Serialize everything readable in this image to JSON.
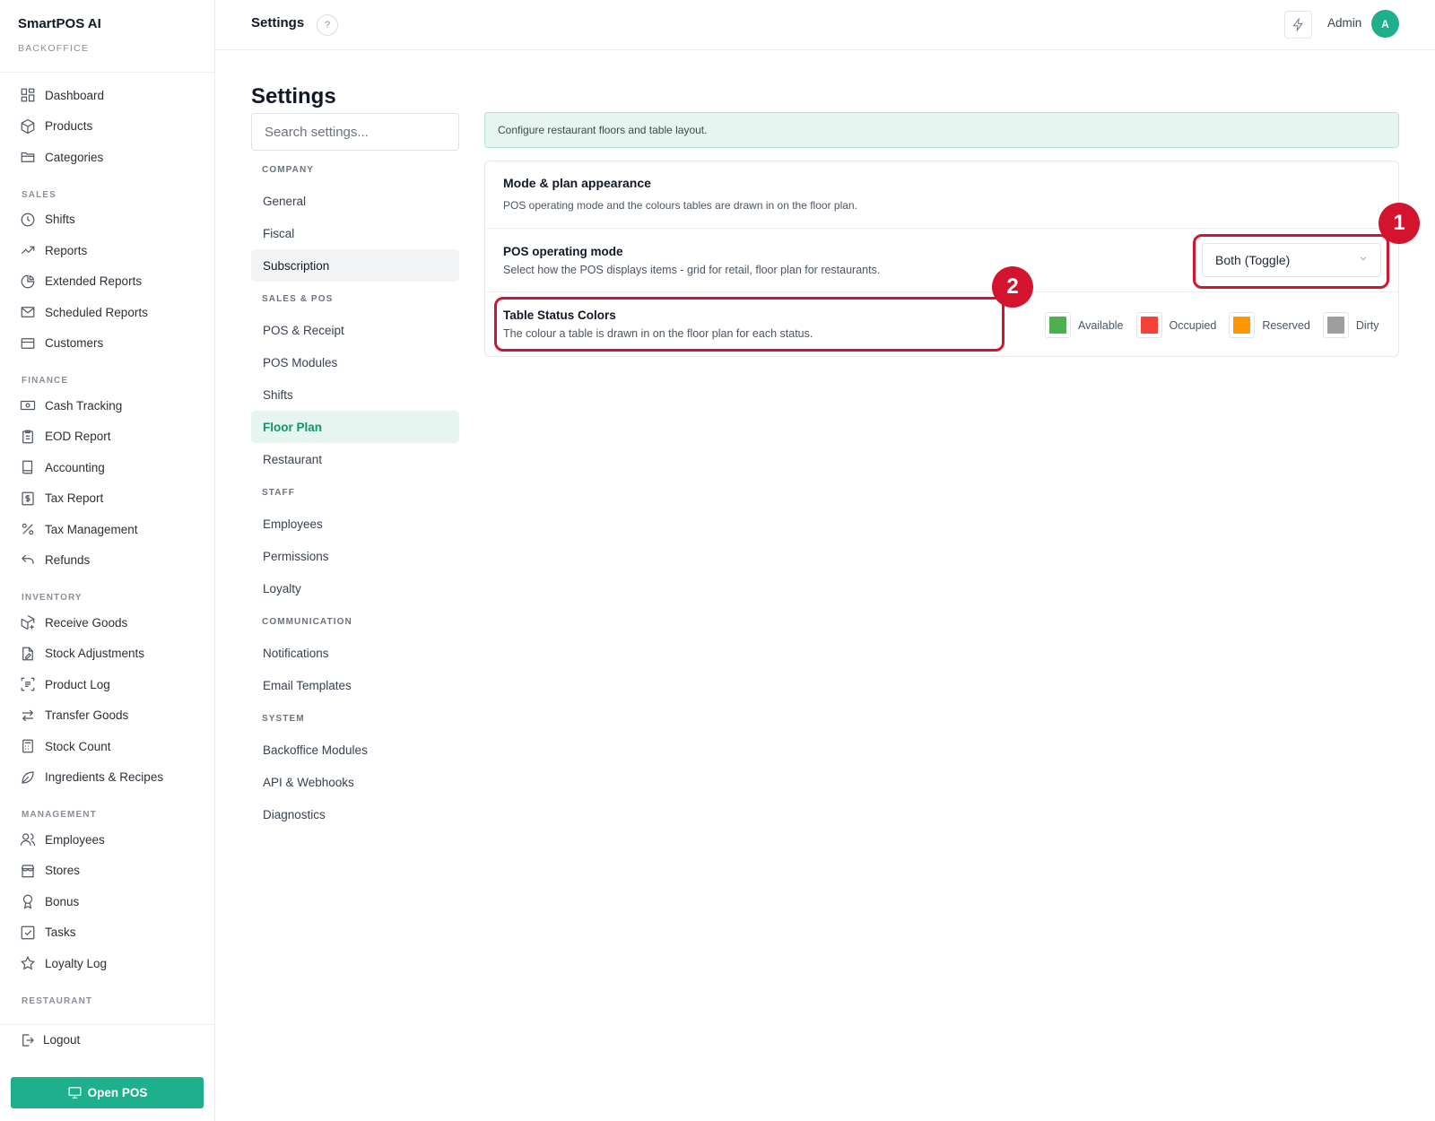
{
  "app": {
    "name": "SmartPOS AI",
    "subtitle": "BACKOFFICE"
  },
  "sidebar": {
    "top_items": [
      {
        "label": "Dashboard",
        "icon": "dashboard-icon"
      },
      {
        "label": "Products",
        "icon": "box-icon"
      },
      {
        "label": "Categories",
        "icon": "folder-icon"
      }
    ],
    "sections": [
      {
        "title": "SALES",
        "items": [
          {
            "label": "Shifts",
            "icon": "clock-icon"
          },
          {
            "label": "Reports",
            "icon": "trend-icon"
          },
          {
            "label": "Extended Reports",
            "icon": "pie-icon"
          },
          {
            "label": "Scheduled Reports",
            "icon": "mail-icon"
          },
          {
            "label": "Customers",
            "icon": "card-icon"
          }
        ]
      },
      {
        "title": "FINANCE",
        "items": [
          {
            "label": "Cash Tracking",
            "icon": "cash-icon"
          },
          {
            "label": "EOD Report",
            "icon": "clipboard-icon"
          },
          {
            "label": "Accounting",
            "icon": "book-icon"
          },
          {
            "label": "Tax Report",
            "icon": "dollar-doc-icon"
          },
          {
            "label": "Tax Management",
            "icon": "percent-icon"
          },
          {
            "label": "Refunds",
            "icon": "undo-icon"
          }
        ]
      },
      {
        "title": "INVENTORY",
        "items": [
          {
            "label": "Receive Goods",
            "icon": "package-plus-icon"
          },
          {
            "label": "Stock Adjustments",
            "icon": "doc-edit-icon"
          },
          {
            "label": "Product Log",
            "icon": "scan-list-icon"
          },
          {
            "label": "Transfer Goods",
            "icon": "transfer-icon"
          },
          {
            "label": "Stock Count",
            "icon": "calculator-icon"
          },
          {
            "label": "Ingredients & Recipes",
            "icon": "leaf-icon"
          }
        ]
      },
      {
        "title": "MANAGEMENT",
        "items": [
          {
            "label": "Employees",
            "icon": "users-icon"
          },
          {
            "label": "Stores",
            "icon": "store-icon"
          },
          {
            "label": "Bonus",
            "icon": "award-icon"
          },
          {
            "label": "Tasks",
            "icon": "checkbox-icon"
          },
          {
            "label": "Loyalty Log",
            "icon": "star-icon"
          }
        ]
      },
      {
        "title": "RESTAURANT",
        "items": []
      }
    ],
    "logout_label": "Logout",
    "open_pos_label": "Open POS"
  },
  "header": {
    "title": "Settings",
    "user_name": "Admin",
    "avatar_initial": "A"
  },
  "settings": {
    "heading": "Settings",
    "search_placeholder": "Search settings...",
    "nav": [
      {
        "title": "COMPANY",
        "items": [
          "General",
          "Fiscal",
          "Subscription"
        ]
      },
      {
        "title": "SALES & POS",
        "items": [
          "POS & Receipt",
          "POS Modules",
          "Shifts",
          "Floor Plan",
          "Restaurant"
        ]
      },
      {
        "title": "STAFF",
        "items": [
          "Employees",
          "Permissions",
          "Loyalty"
        ]
      },
      {
        "title": "COMMUNICATION",
        "items": [
          "Notifications",
          "Email Templates"
        ]
      },
      {
        "title": "SYSTEM",
        "items": [
          "Backoffice Modules",
          "API & Webhooks",
          "Diagnostics"
        ]
      }
    ],
    "hovered_item": "Subscription",
    "active_item": "Floor Plan"
  },
  "main": {
    "banner": "Configure restaurant floors and table layout.",
    "card": {
      "title": "Mode & plan appearance",
      "subtitle": "POS operating mode and the colours tables are drawn in on the floor plan.",
      "mode_row": {
        "title": "POS operating mode",
        "description": "Select how the POS displays items - grid for retail, floor plan for restaurants.",
        "selected_value": "Both (Toggle)"
      },
      "colors_row": {
        "title": "Table Status Colors",
        "description": "The colour a table is drawn in on the floor plan for each status.",
        "statuses": [
          {
            "label": "Available",
            "color": "#4caf50"
          },
          {
            "label": "Occupied",
            "color": "#f44336"
          },
          {
            "label": "Reserved",
            "color": "#ff9800"
          },
          {
            "label": "Dirty",
            "color": "#9e9e9e"
          }
        ]
      }
    }
  },
  "annotations": [
    {
      "number": "1"
    },
    {
      "number": "2"
    }
  ],
  "colors": {
    "accent": "#1eb08d",
    "annotation": "#d4132e",
    "banner_bg": "#e6f5f0"
  }
}
